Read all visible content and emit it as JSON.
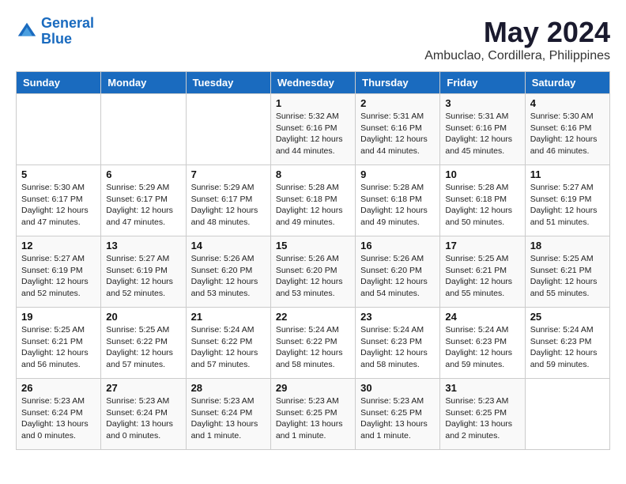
{
  "logo": {
    "line1": "General",
    "line2": "Blue"
  },
  "title": "May 2024",
  "location": "Ambuclao, Cordillera, Philippines",
  "days_of_week": [
    "Sunday",
    "Monday",
    "Tuesday",
    "Wednesday",
    "Thursday",
    "Friday",
    "Saturday"
  ],
  "weeks": [
    [
      {
        "day": "",
        "info": ""
      },
      {
        "day": "",
        "info": ""
      },
      {
        "day": "",
        "info": ""
      },
      {
        "day": "1",
        "info": "Sunrise: 5:32 AM\nSunset: 6:16 PM\nDaylight: 12 hours\nand 44 minutes."
      },
      {
        "day": "2",
        "info": "Sunrise: 5:31 AM\nSunset: 6:16 PM\nDaylight: 12 hours\nand 44 minutes."
      },
      {
        "day": "3",
        "info": "Sunrise: 5:31 AM\nSunset: 6:16 PM\nDaylight: 12 hours\nand 45 minutes."
      },
      {
        "day": "4",
        "info": "Sunrise: 5:30 AM\nSunset: 6:16 PM\nDaylight: 12 hours\nand 46 minutes."
      }
    ],
    [
      {
        "day": "5",
        "info": "Sunrise: 5:30 AM\nSunset: 6:17 PM\nDaylight: 12 hours\nand 47 minutes."
      },
      {
        "day": "6",
        "info": "Sunrise: 5:29 AM\nSunset: 6:17 PM\nDaylight: 12 hours\nand 47 minutes."
      },
      {
        "day": "7",
        "info": "Sunrise: 5:29 AM\nSunset: 6:17 PM\nDaylight: 12 hours\nand 48 minutes."
      },
      {
        "day": "8",
        "info": "Sunrise: 5:28 AM\nSunset: 6:18 PM\nDaylight: 12 hours\nand 49 minutes."
      },
      {
        "day": "9",
        "info": "Sunrise: 5:28 AM\nSunset: 6:18 PM\nDaylight: 12 hours\nand 49 minutes."
      },
      {
        "day": "10",
        "info": "Sunrise: 5:28 AM\nSunset: 6:18 PM\nDaylight: 12 hours\nand 50 minutes."
      },
      {
        "day": "11",
        "info": "Sunrise: 5:27 AM\nSunset: 6:19 PM\nDaylight: 12 hours\nand 51 minutes."
      }
    ],
    [
      {
        "day": "12",
        "info": "Sunrise: 5:27 AM\nSunset: 6:19 PM\nDaylight: 12 hours\nand 52 minutes."
      },
      {
        "day": "13",
        "info": "Sunrise: 5:27 AM\nSunset: 6:19 PM\nDaylight: 12 hours\nand 52 minutes."
      },
      {
        "day": "14",
        "info": "Sunrise: 5:26 AM\nSunset: 6:20 PM\nDaylight: 12 hours\nand 53 minutes."
      },
      {
        "day": "15",
        "info": "Sunrise: 5:26 AM\nSunset: 6:20 PM\nDaylight: 12 hours\nand 53 minutes."
      },
      {
        "day": "16",
        "info": "Sunrise: 5:26 AM\nSunset: 6:20 PM\nDaylight: 12 hours\nand 54 minutes."
      },
      {
        "day": "17",
        "info": "Sunrise: 5:25 AM\nSunset: 6:21 PM\nDaylight: 12 hours\nand 55 minutes."
      },
      {
        "day": "18",
        "info": "Sunrise: 5:25 AM\nSunset: 6:21 PM\nDaylight: 12 hours\nand 55 minutes."
      }
    ],
    [
      {
        "day": "19",
        "info": "Sunrise: 5:25 AM\nSunset: 6:21 PM\nDaylight: 12 hours\nand 56 minutes."
      },
      {
        "day": "20",
        "info": "Sunrise: 5:25 AM\nSunset: 6:22 PM\nDaylight: 12 hours\nand 57 minutes."
      },
      {
        "day": "21",
        "info": "Sunrise: 5:24 AM\nSunset: 6:22 PM\nDaylight: 12 hours\nand 57 minutes."
      },
      {
        "day": "22",
        "info": "Sunrise: 5:24 AM\nSunset: 6:22 PM\nDaylight: 12 hours\nand 58 minutes."
      },
      {
        "day": "23",
        "info": "Sunrise: 5:24 AM\nSunset: 6:23 PM\nDaylight: 12 hours\nand 58 minutes."
      },
      {
        "day": "24",
        "info": "Sunrise: 5:24 AM\nSunset: 6:23 PM\nDaylight: 12 hours\nand 59 minutes."
      },
      {
        "day": "25",
        "info": "Sunrise: 5:24 AM\nSunset: 6:23 PM\nDaylight: 12 hours\nand 59 minutes."
      }
    ],
    [
      {
        "day": "26",
        "info": "Sunrise: 5:23 AM\nSunset: 6:24 PM\nDaylight: 13 hours\nand 0 minutes."
      },
      {
        "day": "27",
        "info": "Sunrise: 5:23 AM\nSunset: 6:24 PM\nDaylight: 13 hours\nand 0 minutes."
      },
      {
        "day": "28",
        "info": "Sunrise: 5:23 AM\nSunset: 6:24 PM\nDaylight: 13 hours\nand 1 minute."
      },
      {
        "day": "29",
        "info": "Sunrise: 5:23 AM\nSunset: 6:25 PM\nDaylight: 13 hours\nand 1 minute."
      },
      {
        "day": "30",
        "info": "Sunrise: 5:23 AM\nSunset: 6:25 PM\nDaylight: 13 hours\nand 1 minute."
      },
      {
        "day": "31",
        "info": "Sunrise: 5:23 AM\nSunset: 6:25 PM\nDaylight: 13 hours\nand 2 minutes."
      },
      {
        "day": "",
        "info": ""
      }
    ]
  ]
}
